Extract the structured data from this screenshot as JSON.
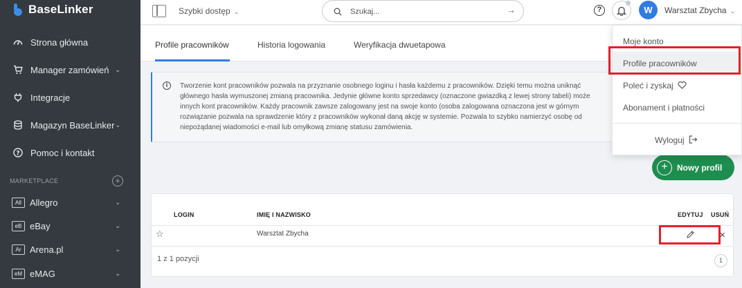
{
  "brand": {
    "name": "BaseLinker",
    "color": "#3b8ee8"
  },
  "sidebar": {
    "items": [
      {
        "label": "Strona główna",
        "icon": "dashboard-icon",
        "has_chevron": false
      },
      {
        "label": "Manager zamówień",
        "icon": "cart-icon",
        "has_chevron": true
      },
      {
        "label": "Integracje",
        "icon": "plug-icon",
        "has_chevron": false
      },
      {
        "label": "Magazyn BaseLinker",
        "icon": "database-icon",
        "has_chevron": true
      },
      {
        "label": "Pomoc i kontakt",
        "icon": "help-circle-icon",
        "has_chevron": false
      }
    ],
    "section_label": "MARKETPLACE",
    "section_add": "+",
    "marketplaces": [
      {
        "badge": "All",
        "label": "Allegro"
      },
      {
        "badge": "eB",
        "label": "eBay"
      },
      {
        "badge": "Ar",
        "label": "Arena.pl"
      },
      {
        "badge": "eM",
        "label": "eMAG"
      }
    ]
  },
  "topbar": {
    "quick_access": "Szybki dostęp",
    "search_placeholder": "Szukaj...",
    "help": "?",
    "avatar_initial": "W",
    "account_name": "Warsztat Zbycha"
  },
  "tabs": [
    {
      "label": "Profile pracowników",
      "active": true
    },
    {
      "label": "Historia logowania",
      "active": false
    },
    {
      "label": "Weryfikacja dwuetapowa",
      "active": false
    }
  ],
  "info": {
    "icon": "i",
    "lines": [
      "Tworzenie kont pracowników pozwala na przyznanie osobnego loginu i hasła każdemu z pracowników. Dzięki temu można uniknąć",
      "głównego hasła wymuszonej zmianą pracownika. Jedynie główne konto sprzedawcy (oznaczone gwiazdką z lewej strony tabeli) może",
      "innych kont pracowników. Każdy pracownik zawsze zalogowany jest na swoje konto (osoba zalogowana oznaczona jest w górnym",
      "rozwiązanie pozwala na sprawdzenie który z pracowników wykonał daną akcję w systemie. Pozwala to szybko namierzyć osobę od",
      "niepożądanej wiadomości e-mail lub omyłkową zmianę statusu zamówienia."
    ]
  },
  "new_profile_button": {
    "label": "Nowy profil",
    "color": "#1e8e4f"
  },
  "table": {
    "columns": {
      "login": "LOGIN",
      "name": "IMIĘ I NAZWISKO",
      "edit": "EDYTUJ",
      "delete": "USUŃ"
    },
    "rows": [
      {
        "login": "",
        "name": "Warsztat Zbycha",
        "is_main": true
      }
    ],
    "pagination": {
      "summary": "1 z 1 pozycji",
      "current_page": "1"
    }
  },
  "dropdown": {
    "items": [
      "Moje konto",
      "Profile pracowników",
      "Poleć i zyskaj",
      "Abonament i płatności"
    ],
    "logout": "Wyloguj"
  },
  "colors": {
    "accent": "#2f7de1",
    "highlight": "#e2202a",
    "sidebar_bg": "#343a40"
  }
}
